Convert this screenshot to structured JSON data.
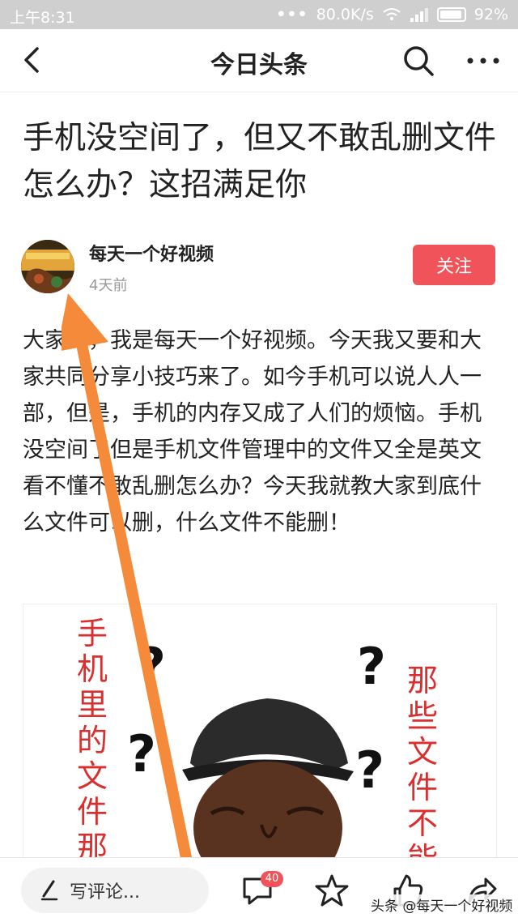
{
  "status_bar": {
    "time": "上午8:31",
    "network_speed": "80.0K/s",
    "battery": "92%",
    "signal_dots": "•••"
  },
  "nav": {
    "title": "今日头条",
    "back_icon": "chevron-left-icon",
    "search_icon": "search-icon",
    "more_icon": "more-dots-icon"
  },
  "article": {
    "title": "手机没空间了，但又不敢乱删文件怎么办？这招满足你",
    "author": "每天一个好视频",
    "time": "4天前",
    "follow_label": "关注",
    "body": "大家好，我是每天一个好视频。今天我又要和大家共同分享小技巧来了。如今手机可以说人人一部，但是，手机的内存又成了人们的烦恼。手机没空间了但是手机文件管理中的文件又全是英文看不懂不敢乱删怎么办？今天我就教大家到底什么文件可以删，什么文件不能删！"
  },
  "image": {
    "left_text": "手机里的文件那些",
    "right_text": "那些文件不能删",
    "question_mark": "?"
  },
  "bottom_bar": {
    "comment_placeholder": "写评论...",
    "comment_count": "40",
    "watermark": "头条 @每天一个好视频"
  },
  "colors": {
    "accent": "#f0535a",
    "arrow": "#f58a3a",
    "image_text": "#d92f2f"
  }
}
